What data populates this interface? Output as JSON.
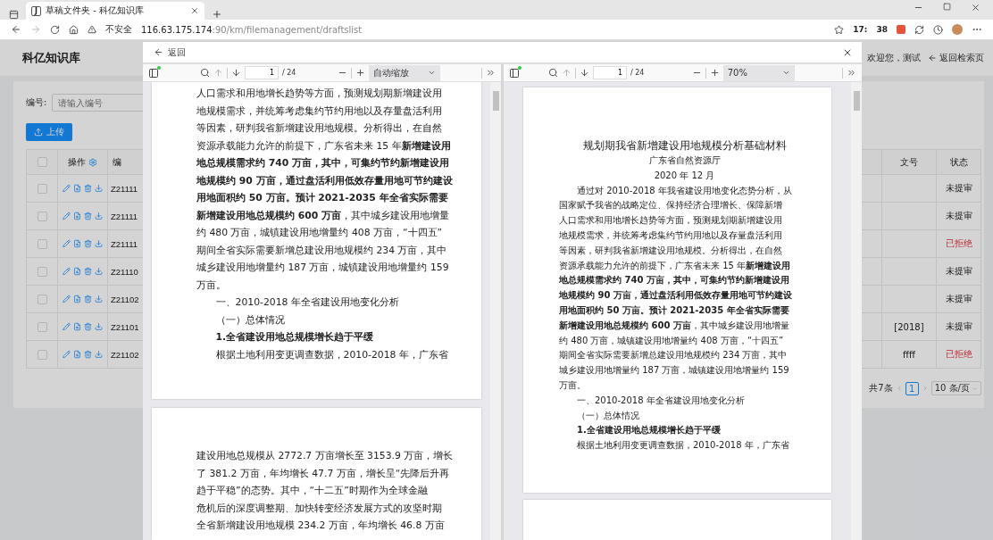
{
  "browser": {
    "tab_letter": "J",
    "tab_title": "草稿文件夹 - 科亿知识库",
    "security": "不安全",
    "url_host": "116.63.175.174",
    "url_path": ":90/km/filemanagement/draftslist",
    "badges": [
      "17:",
      "38"
    ]
  },
  "app": {
    "title": "科亿知识库",
    "welcome": "欢迎您，测试",
    "back_search": "返回检索页",
    "filter_label": "编号:",
    "filter_placeholder": "请输入编号",
    "upload": "上传",
    "table": {
      "all_checked": false,
      "columns": [
        {
          "kind": "checkbox"
        },
        {
          "kind": "actions",
          "label": "操作"
        },
        {
          "kind": "id",
          "label": "编"
        },
        {
          "kind": "doc",
          "label": "文号"
        },
        {
          "kind": "status",
          "label": "状态"
        }
      ],
      "rows": [
        {
          "checked": false,
          "id": "Z21111",
          "status": "未提审",
          "rejected": false
        },
        {
          "checked": false,
          "id": "Z21111",
          "status": "未提审",
          "rejected": false
        },
        {
          "checked": false,
          "id": "Z21111",
          "status": "已拒绝",
          "rejected": true
        },
        {
          "checked": false,
          "id": "Z21110",
          "status": "未提审",
          "rejected": false
        },
        {
          "checked": false,
          "id": "Z21102",
          "status": "未提审",
          "rejected": false
        },
        {
          "checked": false,
          "id": "Z21101",
          "doc": "[2018]",
          "status": "未提审",
          "rejected": false
        },
        {
          "checked": false,
          "id": "Z21102",
          "doc": "ffff",
          "status": "已拒绝",
          "rejected": true
        }
      ]
    },
    "pagination": {
      "total": "共7条",
      "page": "1",
      "size": "10 条/页"
    }
  },
  "modal": {
    "back": "返回",
    "viewers": [
      {
        "page": "1",
        "pages": "/ 24",
        "zoom": "自动缩放",
        "doc_pages": [
          {
            "kind": "page",
            "lines": [
              {
                "kind": "body",
                "text": "人口需求和用地增长趋势等方面，预测规划期新增建设用"
              },
              {
                "kind": "body",
                "text": "地规模需求，并统筹考虑集约节约用地以及存量盘活利用"
              },
              {
                "kind": "body",
                "text": "等因素，研判我省新增建设用地规模。分析得出，在自然"
              },
              {
                "kind": "body",
                "text": "资源承载能力允许的前提下，广东省未来 15 年**新增建设用**"
              },
              {
                "kind": "bold",
                "text": "地总规模需求约 740 万亩，其中，可集约节约新增建设用"
              },
              {
                "kind": "bold",
                "text": "地规模约 90 万亩，通过盘活利用低效存量用地可节约建设"
              },
              {
                "kind": "bold",
                "text": "用地面积约 50 万亩。预计 2021-2035 年全省实际需要"
              },
              {
                "kind": "body",
                "text": "**新增建设用地总规模约 600 万亩**，其中城乡建设用地增量"
              },
              {
                "kind": "body",
                "text": "约 480 万亩，城镇建设用地增量约 408 万亩，“十四五”"
              },
              {
                "kind": "body",
                "text": "期间全省实际需要新增总建设用地规模约 234 万亩，其中"
              },
              {
                "kind": "body",
                "text": "城乡建设用地增量约 187 万亩，城镇建设用地增量约 159"
              },
              {
                "kind": "body",
                "text": "万亩。"
              },
              {
                "kind": "indent",
                "text": "一、2010-2018 年全省建设用地变化分析"
              },
              {
                "kind": "indent",
                "text": "（一）总体情况"
              },
              {
                "kind": "heading",
                "text": "1.全省建设用地总规模增长趋于平缓"
              },
              {
                "kind": "indent",
                "text": "根据土地利用变更调查数据，2010-2018 年，广东省"
              }
            ]
          },
          {
            "kind": "page",
            "lines": [
              {
                "kind": "body",
                "text": "建设用地总规模从 2772.7 万亩增长至 3153.9 万亩，增长"
              },
              {
                "kind": "body",
                "text": "了 381.2 万亩，年均增长 47.7 万亩，增长呈“先降后升再"
              },
              {
                "kind": "body",
                "text": "趋于平稳”的态势。其中，“十二五”时期作为全球金融"
              },
              {
                "kind": "body",
                "text": "危机后的深度调整期、加快转变经济发展方式的攻坚时期"
              },
              {
                "kind": "body",
                "text": "全省新增建设用地规模 234.2 万亩，年均增长 46.8 万亩"
              }
            ]
          }
        ]
      },
      {
        "page": "1",
        "pages": "/ 24",
        "zoom": "70%",
        "doc_pages": [
          {
            "kind": "page",
            "lines": [
              {
                "kind": "title",
                "text": "规划期我省新增建设用地规模分析基础材料"
              },
              {
                "kind": "center",
                "text": "广东省自然资源厅"
              },
              {
                "kind": "center",
                "text": "2020 年 12 月"
              },
              {
                "kind": "indent",
                "text": "通过对 2010-2018 年我省建设用地变化态势分析，从"
              },
              {
                "kind": "body",
                "text": "国家赋予我省的战略定位、保持经济合理增长、保障新增"
              },
              {
                "kind": "body",
                "text": "人口需求和用地增长趋势等方面，预测规划期新增建设用"
              },
              {
                "kind": "body",
                "text": "地规模需求，并统筹考虑集约节约用地以及存量盘活利用"
              },
              {
                "kind": "body",
                "text": "等因素，研判我省新增建设用地规模。分析得出，在自然"
              },
              {
                "kind": "body",
                "text": "资源承载能力允许的前提下，广东省未来 15 年**新增建设用**"
              },
              {
                "kind": "bold",
                "text": "地总规模需求约 740 万亩，其中，可集约节约新增建设用"
              },
              {
                "kind": "bold",
                "text": "地规模约 90 万亩，通过盘活利用低效存量用地可节约建设"
              },
              {
                "kind": "bold",
                "text": "用地面积约 50 万亩。预计 2021-2035 年全省实际需要"
              },
              {
                "kind": "body",
                "text": "**新增建设用地总规模约 600 万亩**，其中城乡建设用地增量"
              },
              {
                "kind": "body",
                "text": "约 480 万亩，城镇建设用地增量约 408 万亩，“十四五”"
              },
              {
                "kind": "body",
                "text": "期间全省实际需要新增总建设用地规模约 234 万亩，其中"
              },
              {
                "kind": "body",
                "text": "城乡建设用地增量约 187 万亩，城镇建设用地增量约 159"
              },
              {
                "kind": "body",
                "text": "万亩。"
              },
              {
                "kind": "indent",
                "text": "一、2010-2018 年全省建设用地变化分析"
              },
              {
                "kind": "indent",
                "text": "（一）总体情况"
              },
              {
                "kind": "heading",
                "text": "1.全省建设用地总规模增长趋于平缓"
              },
              {
                "kind": "indent",
                "text": "根据土地利用变更调查数据，2010-2018 年，广东省"
              }
            ]
          },
          {
            "kind": "page"
          }
        ]
      }
    ]
  }
}
